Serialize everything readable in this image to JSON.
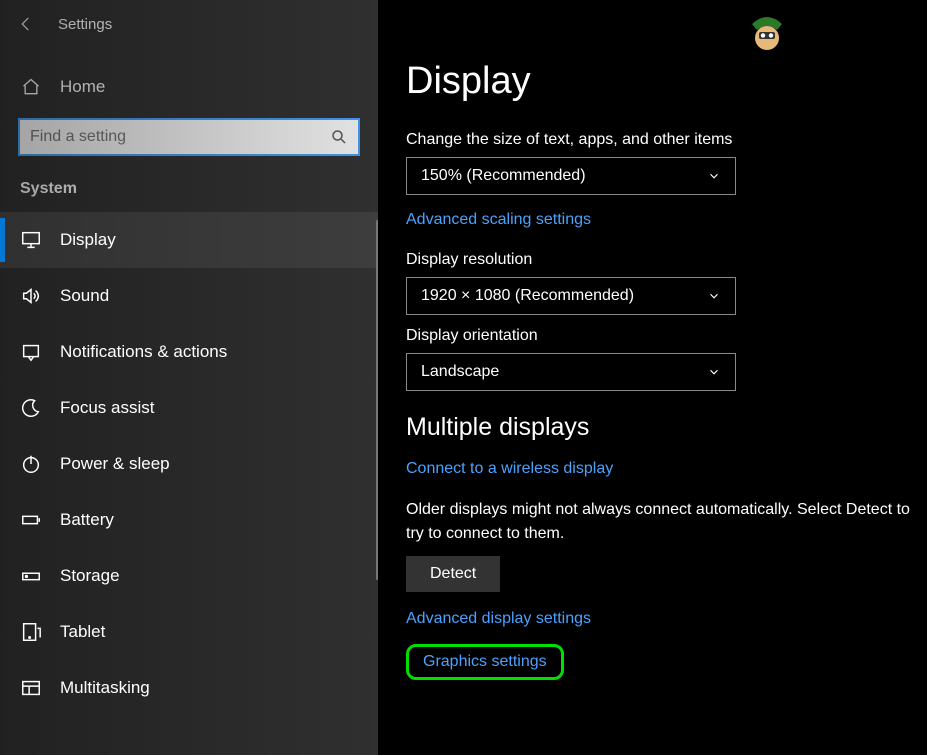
{
  "topbar": {
    "title": "Settings"
  },
  "sidebar": {
    "home_label": "Home",
    "search_placeholder": "Find a setting",
    "section_label": "System",
    "items": [
      {
        "label": "Display",
        "icon": "monitor-icon",
        "active": true
      },
      {
        "label": "Sound",
        "icon": "sound-icon"
      },
      {
        "label": "Notifications & actions",
        "icon": "notification-icon"
      },
      {
        "label": "Focus assist",
        "icon": "moon-icon"
      },
      {
        "label": "Power & sleep",
        "icon": "power-icon"
      },
      {
        "label": "Battery",
        "icon": "battery-icon"
      },
      {
        "label": "Storage",
        "icon": "storage-icon"
      },
      {
        "label": "Tablet",
        "icon": "tablet-icon"
      },
      {
        "label": "Multitasking",
        "icon": "multitask-icon"
      }
    ]
  },
  "main": {
    "title": "Display",
    "scale_section_label": "Change the size of text, apps, and other items",
    "scale_value": "150% (Recommended)",
    "advanced_scaling_link": "Advanced scaling settings",
    "resolution_label": "Display resolution",
    "resolution_value": "1920 × 1080 (Recommended)",
    "orientation_label": "Display orientation",
    "orientation_value": "Landscape",
    "multiple_displays_header": "Multiple displays",
    "wireless_link": "Connect to a wireless display",
    "detect_text": "Older displays might not always connect automatically. Select Detect to try to connect to them.",
    "detect_button": "Detect",
    "advanced_display_link": "Advanced display settings",
    "graphics_link": "Graphics settings"
  }
}
